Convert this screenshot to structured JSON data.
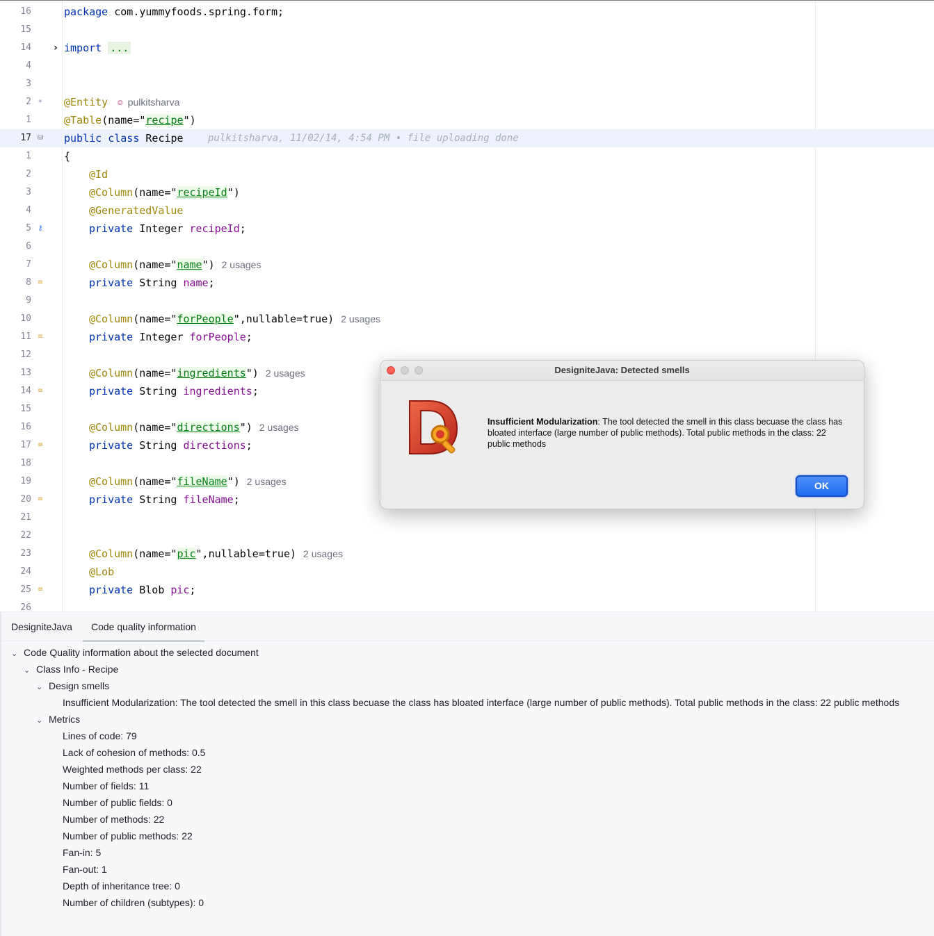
{
  "editor": {
    "lines": [
      {
        "ln": "16",
        "keyword": "package",
        "text": " com.yummyfoods.spring.form;"
      },
      {
        "ln": "15"
      },
      {
        "ln": "14",
        "keyword": "import",
        "collapsed": "..."
      },
      {
        "ln": "4"
      },
      {
        "ln": "3"
      },
      {
        "ln": "2",
        "annotation": "@Entity",
        "author": "pulkitsharva"
      },
      {
        "ln": "1",
        "annotation": "@Table",
        "open": "(name=\"",
        "value": "recipe",
        "close": "\")"
      },
      {
        "ln": "17",
        "keyword": "public class",
        "classname": " Recipe",
        "blame": "pulkitsharva, 11/02/14, 4:54 PM • file uploading done"
      },
      {
        "ln": "1",
        "brace": "{"
      },
      {
        "ln": "2",
        "annotation": "@Id"
      },
      {
        "ln": "3",
        "annotation": "@Column",
        "open": "(name=\"",
        "value": "recipeId",
        "close": "\")"
      },
      {
        "ln": "4",
        "annotation": "@GeneratedValue"
      },
      {
        "ln": "5",
        "keyword": "private",
        "type": " Integer ",
        "field": "recipeId",
        "end": ";"
      },
      {
        "ln": "6"
      },
      {
        "ln": "7",
        "annotation": "@Column",
        "open": "(name=\"",
        "value": "name",
        "close": "\")",
        "usages": "2 usages"
      },
      {
        "ln": "8",
        "keyword": "private",
        "type": " String ",
        "field": "name",
        "end": ";"
      },
      {
        "ln": "9"
      },
      {
        "ln": "10",
        "annotation": "@Column",
        "open": "(name=\"",
        "value": "forPeople",
        "close": "\",nullable=true)",
        "usages": "2 usages"
      },
      {
        "ln": "11",
        "keyword": "private",
        "type": " Integer ",
        "field": "forPeople",
        "end": ";"
      },
      {
        "ln": "12"
      },
      {
        "ln": "13",
        "annotation": "@Column",
        "open": "(name=\"",
        "value": "ingredients",
        "close": "\")",
        "usages": "2 usages"
      },
      {
        "ln": "14",
        "keyword": "private",
        "type": " String ",
        "field": "ingredients",
        "end": ";"
      },
      {
        "ln": "15"
      },
      {
        "ln": "16",
        "annotation": "@Column",
        "open": "(name=\"",
        "value": "directions",
        "close": "\")",
        "usages": "2 usages"
      },
      {
        "ln": "17",
        "keyword": "private",
        "type": " String ",
        "field": "directions",
        "end": ";"
      },
      {
        "ln": "18"
      },
      {
        "ln": "19",
        "annotation": "@Column",
        "open": "(name=\"",
        "value": "fileName",
        "close": "\")",
        "usages": "2 usages"
      },
      {
        "ln": "20",
        "keyword": "private",
        "type": " String ",
        "field": "fileName",
        "end": ";"
      },
      {
        "ln": "21"
      },
      {
        "ln": "22"
      },
      {
        "ln": "23",
        "annotation": "@Column",
        "open": "(name=\"",
        "value": "pic",
        "close": "\",nullable=true)",
        "usages": "2 usages"
      },
      {
        "ln": "24",
        "annotation": "@Lob"
      },
      {
        "ln": "25",
        "keyword": "private",
        "type": " Blob ",
        "field": "pic",
        "end": ";"
      },
      {
        "ln": "26"
      }
    ]
  },
  "panel": {
    "title": "DesigniteJava",
    "tab": "Code quality information",
    "root": "Code Quality information about the selected document",
    "class_info": "Class Info - Recipe",
    "design_smells_label": "Design smells",
    "smell": "Insufficient Modularization: The tool detected the smell in this class becuase the class has bloated interface (large number of public methods). Total public methods in the class: 22 public methods",
    "metrics_label": "Metrics",
    "metrics": [
      "Lines of code: 79",
      "Lack of cohesion of methods: 0.5",
      "Weighted methods per class: 22",
      "Number of fields: 11",
      "Number of public fields: 0",
      "Number of methods: 22",
      "Number of public methods: 22",
      "Fan-in: 5",
      "Fan-out: 1",
      "Depth of inheritance tree: 0",
      "Number of children (subtypes): 0"
    ]
  },
  "dialog": {
    "title": "DesigniteJava: Detected smells",
    "smell_name": "Insufficient Modularization",
    "message": ": The tool detected the smell in this class becuase the class has bloated interface (large number of public methods). Total public methods in the class: 22 public methods",
    "ok_label": "OK"
  },
  "colors": {
    "keyword": "#0033b3",
    "annotation": "#9e880d",
    "string": "#067d17",
    "field": "#871094",
    "ok_button": "#1f6ef0",
    "current_line": "#edf2fc"
  }
}
